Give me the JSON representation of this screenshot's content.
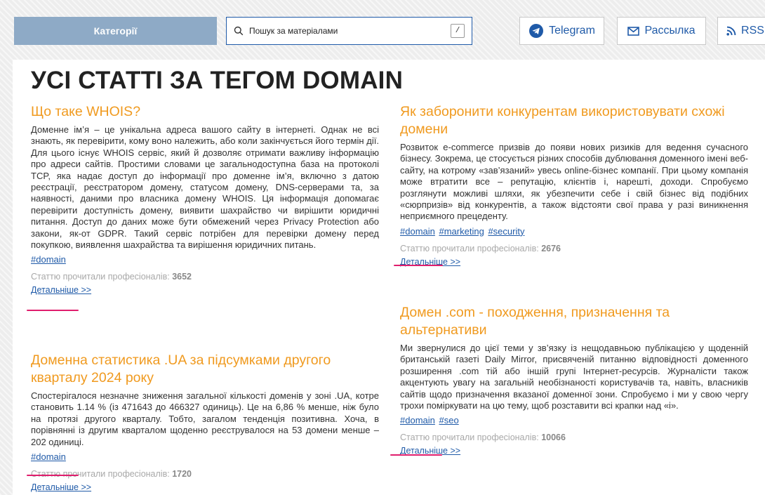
{
  "header": {
    "categories_label": "Категорії",
    "search": {
      "placeholder": "Пошук за матеріалами",
      "shortcut": "/"
    },
    "telegram_label": "Telegram",
    "newsletter_label": "Рассылка",
    "rss_label": "RSS"
  },
  "colors": {
    "accent_orange": "#f09a1f",
    "link_blue": "#1f5aa8",
    "categories_bg": "#8eaac6",
    "tag_highlight": "#e01e6d"
  },
  "page": {
    "title": "УСІ СТАТТІ ЗА ТЕГОМ DOMAIN",
    "read_label": "Статтю прочитали професіоналів:",
    "more_label": "Детальніше >>"
  },
  "articles": [
    {
      "title": "Що таке WHOIS?",
      "description": "Доменне ім’я – це унікальна адреса вашого сайту в інтернеті. Однак не всі знають, як перевірити, кому воно належить, або коли закінчується його термін дії. Для цього існує WHOIS сервіс, який й дозволяє отримати важливу інформацію про адреси сайтів. Простими словами це загальнодоступна база на протоколі TCP, яка надає доступ до інформації про доменне ім’я, включно з датою реєстрації, реєстратором домену, статусом домену, DNS-серверами та, за наявності, даними про власника домену WHOIS. Ця інформація допомагає перевірити доступність домену, виявити шахрайство чи вирішити юридичні питання. Доступ до даних може бути обмежений через Privacy Protection або закони, як-от GDPR. Такий сервіс потрібен для перевірки домену перед покупкою, виявлення шахрайства та вирішення юридичних питань.",
      "tags": [
        "#domain"
      ],
      "reads": "3652"
    },
    {
      "title": "Доменна статистика .UA за підсумками другого кварталу 2024 року",
      "description": "Спостерігалося незначне зниження загальної кількості доменів у зоні .UA, котре становить 1.14 % (із 471643 до 466327 одиниць). Це на 6,86 % менше, ніж було на протязі другого кварталу. Тобто, загалом тенденція позитивна. Хоча, в порівнянні із другим кварталом щоденно реєструвалося на 53 домени менше – 202 одиниці.",
      "tags": [
        "#domain"
      ],
      "reads": "1720"
    },
    {
      "title": "Як заборонити конкурентам використовувати схожі домени",
      "description": "Розвиток e-commerce призвів до появи нових ризиків для ведення сучасного бізнесу. Зокрема, це стосується різних способів дублювання доменного імені веб-сайту, на котрому «зав’язаний» увесь online-бізнес компанії. При цьому компанія може втратити все – репутацію, клієнтів і, нарешті, доходи. Спробуємо розглянути можливі шляхи, як убезпечити себе і свій бізнес від подібних «сюрпризів» від конкурентів, а також відстояти свої права у разі виникнення неприємного прецеденту.",
      "tags": [
        "#domain",
        "#marketing",
        "#security"
      ],
      "reads": "2676"
    },
    {
      "title": "Домен .com - походження, призначення та альтернативи",
      "description": "Ми звернулися до цієї теми у зв’язку із нещодавньою публікацією у щоденній британській газеті Daily Mirror, присвяченій питанню відповідності доменного розширення .com тій або іншій групі Інтернет-ресурсів. Журналісти також акцентують увагу на загальній необізнаності користувачів та, навіть, власників сайтів щодо призначення вказаної доменної зони. Спробуємо і ми у свою чергу трохи поміркувати на цю тему, щоб розставити всі крапки над «і».",
      "tags": [
        "#domain",
        "#seo"
      ],
      "reads": "10066"
    }
  ]
}
